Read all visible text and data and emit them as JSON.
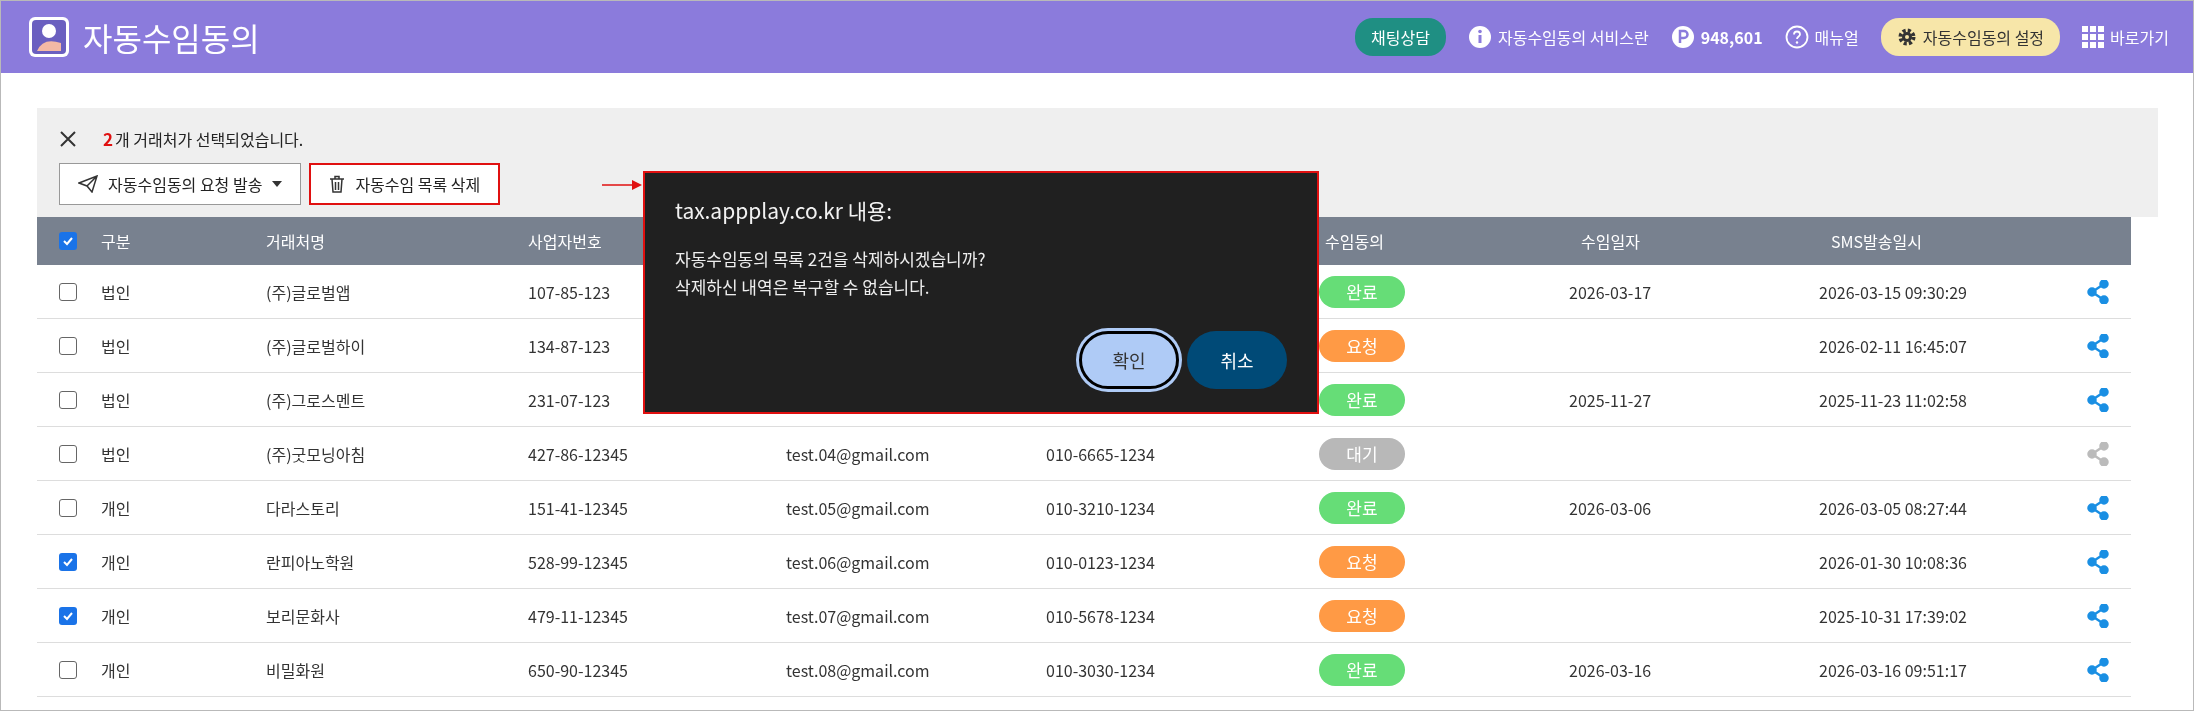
{
  "header": {
    "title": "자동수임동의",
    "chat_button": "채팅상담",
    "service_link": "자동수임동의 서비스란",
    "points": "948,601",
    "manual_link": "매뉴얼",
    "settings_button": "자동수임동의 설정",
    "shortcut_link": "바로가기"
  },
  "selection": {
    "count": "2",
    "message": "개 거래처가 선택되었습니다."
  },
  "actions": [
    {
      "kind": "send",
      "label": "자동수임동의 요청 발송",
      "highlighted": false
    },
    {
      "kind": "delete",
      "label": "자동수임 목록 삭제",
      "highlighted": true
    }
  ],
  "table": {
    "all_checked": true,
    "headers": {
      "type": "구분",
      "name": "거래처명",
      "biz": "사업자번호",
      "consent": "수임동의",
      "date": "수임일자",
      "sms": "SMS발송일시"
    },
    "rows": [
      {
        "checked": false,
        "type": "법인",
        "name": "(주)글로벌앱",
        "biz": "107-85-123",
        "consent": {
          "label": "완료",
          "color": "#66dd77"
        },
        "date": "2026-03-17",
        "sms": "2026-03-15 09:30:29",
        "share_active": true
      },
      {
        "checked": false,
        "type": "법인",
        "name": "(주)글로벌하이",
        "biz": "134-87-123",
        "consent": {
          "label": "요청",
          "color": "#ff9a45"
        },
        "sms": "2026-02-11 16:45:07",
        "share_active": true
      },
      {
        "checked": false,
        "type": "법인",
        "name": "(주)그로스멘트",
        "biz": "231-07-123",
        "consent": {
          "label": "완료",
          "color": "#66dd77"
        },
        "date": "2025-11-27",
        "sms": "2025-11-23 11:02:58",
        "share_active": true
      },
      {
        "checked": false,
        "type": "법인",
        "name": "(주)굿모닝아침",
        "biz": "427-86-12345",
        "email": "test.04@gmail.com",
        "phone": "010-6665-1234",
        "consent": {
          "label": "대기",
          "color": "#b8b8b8"
        },
        "share_active": false
      },
      {
        "checked": false,
        "type": "개인",
        "name": "다라스토리",
        "biz": "151-41-12345",
        "email": "test.05@gmail.com",
        "phone": "010-3210-1234",
        "consent": {
          "label": "완료",
          "color": "#66dd77"
        },
        "date": "2026-03-06",
        "sms": "2026-03-05 08:27:44",
        "share_active": true
      },
      {
        "checked": true,
        "type": "개인",
        "name": "란피아노학원",
        "biz": "528-99-12345",
        "email": "test.06@gmail.com",
        "phone": "010-0123-1234",
        "consent": {
          "label": "요청",
          "color": "#ff9a45"
        },
        "sms": "2026-01-30 10:08:36",
        "share_active": true
      },
      {
        "checked": true,
        "type": "개인",
        "name": "보리문화사",
        "biz": "479-11-12345",
        "email": "test.07@gmail.com",
        "phone": "010-5678-1234",
        "consent": {
          "label": "요청",
          "color": "#ff9a45"
        },
        "sms": "2025-10-31 17:39:02",
        "share_active": true
      },
      {
        "checked": false,
        "type": "개인",
        "name": "비밀화원",
        "biz": "650-90-12345",
        "email": "test.08@gmail.com",
        "phone": "010-3030-1234",
        "consent": {
          "label": "완료",
          "color": "#66dd77"
        },
        "date": "2026-03-16",
        "sms": "2026-03-16 09:51:17",
        "share_active": true
      }
    ]
  },
  "dialog": {
    "highlighted": true,
    "title": "tax.appplay.co.kr 내용:",
    "lines": [
      "자동수임동의 목록 2건을 삭제하시겠습니까?",
      "삭제하신 내역은 복구할 수 없습니다."
    ],
    "buttons": [
      {
        "kind": "confirm",
        "label": "확인",
        "focused": true
      },
      {
        "kind": "cancel",
        "label": "취소",
        "focused": false
      }
    ]
  }
}
